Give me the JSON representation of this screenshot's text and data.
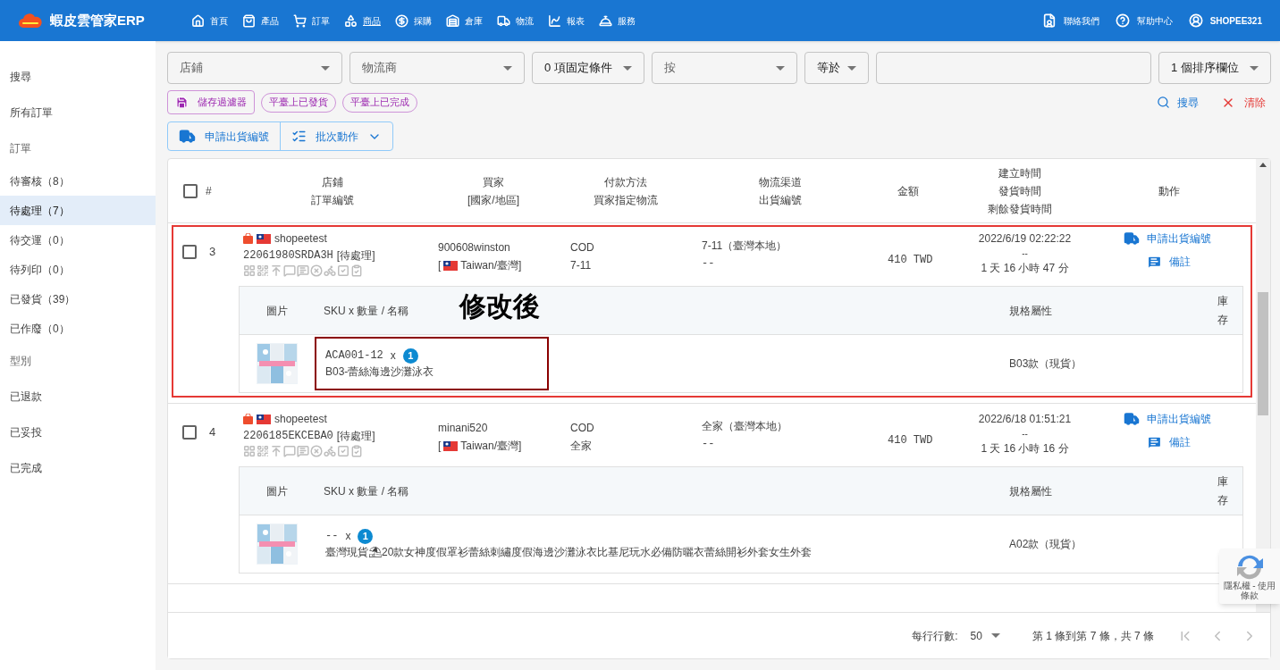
{
  "app": {
    "title": "蝦皮雲管家ERP"
  },
  "nav": [
    {
      "label": "首頁",
      "selected": false
    },
    {
      "label": "產品",
      "selected": false
    },
    {
      "label": "訂單",
      "selected": false
    },
    {
      "label": "商品",
      "selected": true
    },
    {
      "label": "採購",
      "selected": false
    },
    {
      "label": "倉庫",
      "selected": false
    },
    {
      "label": "物流",
      "selected": false
    },
    {
      "label": "報表",
      "selected": false
    },
    {
      "label": "服務",
      "selected": false
    }
  ],
  "header_links": [
    {
      "label": "聯絡我們"
    },
    {
      "label": "幫助中心"
    },
    {
      "label": "SHOPEE321"
    }
  ],
  "sidebar": [
    {
      "label": "搜尋",
      "kind": "item",
      "selected": false
    },
    {
      "label": "所有訂單",
      "kind": "item",
      "selected": false
    },
    {
      "label": "訂單",
      "kind": "header"
    },
    {
      "label": "待審核（8）",
      "kind": "item",
      "selected": false
    },
    {
      "label": "待處理（7）",
      "kind": "item",
      "selected": true
    },
    {
      "label": "待交運（0）",
      "kind": "item",
      "selected": false
    },
    {
      "label": "待列印（0）",
      "kind": "item",
      "selected": false
    },
    {
      "label": "已發貨（39）",
      "kind": "item",
      "selected": false
    },
    {
      "label": "已作廢（0）",
      "kind": "item",
      "selected": false
    },
    {
      "label": "型別",
      "kind": "header"
    },
    {
      "label": "已退款",
      "kind": "item",
      "selected": false
    },
    {
      "label": "已妥投",
      "kind": "item",
      "selected": false
    },
    {
      "label": "已完成",
      "kind": "item",
      "selected": false
    }
  ],
  "filters": [
    {
      "kind": "select",
      "value": "店鋪",
      "muted": true
    },
    {
      "kind": "select",
      "value": "物流商",
      "muted": true
    },
    {
      "kind": "select",
      "value": "0 項固定條件",
      "muted": false
    },
    {
      "kind": "select",
      "value": "按",
      "muted": true
    },
    {
      "kind": "select",
      "value": "等於",
      "muted": false
    },
    {
      "kind": "input"
    },
    {
      "kind": "select",
      "value": "1 個排序欄位",
      "muted": false
    }
  ],
  "save_filter": "儲存過濾器",
  "chips": [
    "平臺上已發貨",
    "平臺上已完成"
  ],
  "search_button": "搜尋",
  "clear_button": "清除",
  "actions": [
    {
      "label": "申請出貨編號",
      "kind": "truck"
    },
    {
      "label": "批次動作",
      "kind": "batch"
    }
  ],
  "table": {
    "select_all_checked": false,
    "columns": [
      [
        "#"
      ],
      [
        "店鋪",
        "訂單編號"
      ],
      [
        "買家",
        "[國家/地區]"
      ],
      [
        "付款方法",
        "買家指定物流"
      ],
      [
        "物流渠道",
        "出貨編號"
      ],
      [
        "金額"
      ],
      [
        "建立時間",
        "發貨時間",
        "剩餘發貨時間"
      ],
      [
        "動作"
      ]
    ],
    "rows": [
      {
        "no": "3",
        "checked": false,
        "store": "shopeetest",
        "order_id": "22061980SRDA3H",
        "status": "[待處理]",
        "buyer": "900608winston",
        "country_open": "[",
        "country": "Taiwan/臺灣",
        "country_close": "]",
        "payment": "COD",
        "shipping": "7-11",
        "channel": "7-11（臺灣本地）",
        "tracking": "--",
        "amount": "410 TWD",
        "created": "2022/6/19 02:22:22",
        "shipped": "--",
        "remaining": "1 天 16 小時 47 分",
        "row_actions": [
          "申請出貨編號",
          "備註"
        ],
        "annotation": "修改後",
        "item_columns": [
          "圖片",
          "SKU x 數量 / 名稱",
          "規格屬性",
          "庫存"
        ],
        "items": [
          {
            "sku": "ACA001-12",
            "x": "x",
            "qty": "1",
            "name": "B03-蕾絲海邊沙灘泳衣",
            "spec": "B03款（現貨）",
            "marked": true
          }
        ]
      },
      {
        "no": "4",
        "checked": false,
        "store": "shopeetest",
        "order_id": "2206185EKCEBA0",
        "status": "[待處理]",
        "buyer": "minani520",
        "country_open": "[",
        "country": "Taiwan/臺灣",
        "country_close": "]",
        "payment": "COD",
        "shipping": "全家",
        "channel": "全家（臺灣本地）",
        "tracking": "--",
        "amount": "410 TWD",
        "created": "2022/6/18 01:51:21",
        "shipped": "--",
        "remaining": "1 天 16 小時 16 分",
        "row_actions": [
          "申請出貨編號",
          "備註"
        ],
        "item_columns": [
          "圖片",
          "SKU x 數量 / 名稱",
          "規格屬性",
          "庫存"
        ],
        "items": [
          {
            "sku": "--",
            "x": "x",
            "qty": "1",
            "name": "臺灣現貨⛱20款女神度假罩衫蕾絲刺繡度假海邊沙灘泳衣比基尼玩水必備防曬衣蕾絲開衫外套女生外套",
            "spec": "A02款（現貨）",
            "marked": false
          }
        ]
      }
    ]
  },
  "pagination": {
    "rows_label": "每行行數:",
    "rows_value": "50",
    "range": "第 1 條到第 7 條，共 7 條"
  },
  "recaptcha": {
    "text": "隱私權 - 使用條款"
  }
}
